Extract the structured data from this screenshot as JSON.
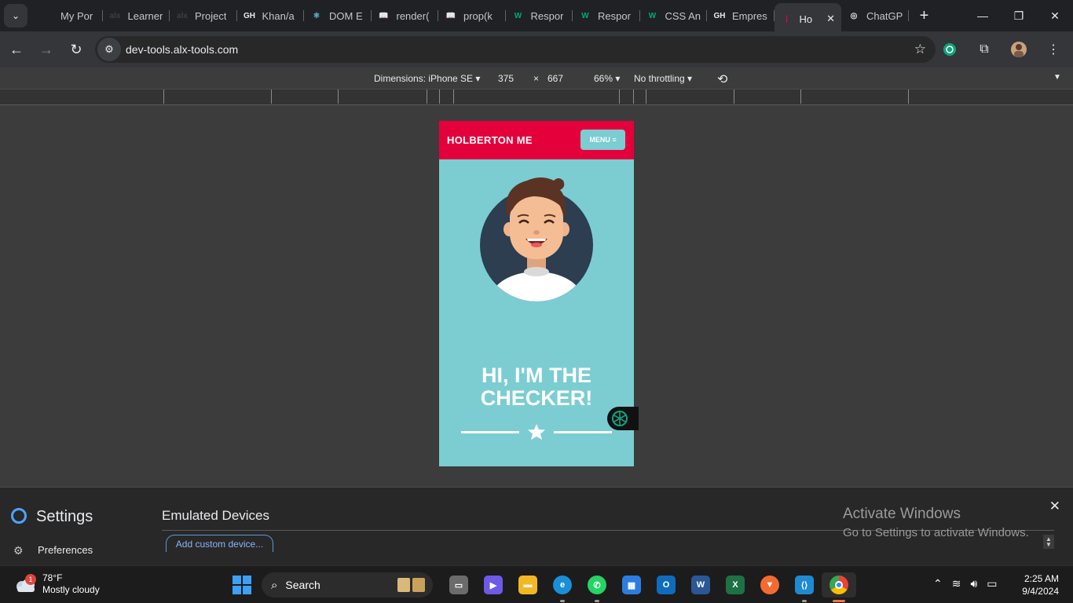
{
  "browser": {
    "tabs": [
      {
        "label": "My Por",
        "fav_color": "#1a73e8",
        "fav_text": ""
      },
      {
        "label": "Learner",
        "fav_color": "#3c4043",
        "fav_text": "alx"
      },
      {
        "label": "Project",
        "fav_color": "#3c4043",
        "fav_text": "alx"
      },
      {
        "label": "Khan/a",
        "fav_color": "#e8eaed",
        "fav_text": "GH"
      },
      {
        "label": "DOM E",
        "fav_color": "#58c4dc",
        "fav_text": "⚛"
      },
      {
        "label": "render(",
        "fav_color": "#e8eaed",
        "fav_text": "📖"
      },
      {
        "label": "prop(k",
        "fav_color": "#e8eaed",
        "fav_text": "📖"
      },
      {
        "label": "Respor",
        "fav_color": "#04aa6d",
        "fav_text": "W"
      },
      {
        "label": "Respor",
        "fav_color": "#04aa6d",
        "fav_text": "W"
      },
      {
        "label": "CSS An",
        "fav_color": "#04aa6d",
        "fav_text": "W"
      },
      {
        "label": "Empres",
        "fav_color": "#e8eaed",
        "fav_text": "GH"
      },
      {
        "label": "Ho",
        "fav_color": "#e4003b",
        "fav_text": "|",
        "active": true
      },
      {
        "label": "ChatGP",
        "fav_color": "#e8eaed",
        "fav_text": "◎"
      }
    ],
    "url": "dev-tools.alx-tools.com"
  },
  "devtools": {
    "dimensions_label": "Dimensions: iPhone SE",
    "width": "375",
    "times": "×",
    "height": "667",
    "zoom": "66%",
    "throttling": "No throttling"
  },
  "site": {
    "brand": "HOLBERTON ME",
    "menu_label": "MENU ≡",
    "hero_line1": "HI, I'M THE",
    "hero_line2": "CHECKER!",
    "header_color": "#e4003b",
    "body_color": "#7bcdd2"
  },
  "settings": {
    "title": "Settings",
    "preferences": "Preferences",
    "emulated_title": "Emulated Devices",
    "add_custom": "Add custom device..."
  },
  "watermark": {
    "line1": "Activate Windows",
    "line2": "Go to Settings to activate Windows."
  },
  "taskbar": {
    "temp": "78°F",
    "condition": "Mostly cloudy",
    "weather_badge": "1",
    "search": "Search",
    "time": "2:25 AM",
    "date": "9/4/2024"
  }
}
